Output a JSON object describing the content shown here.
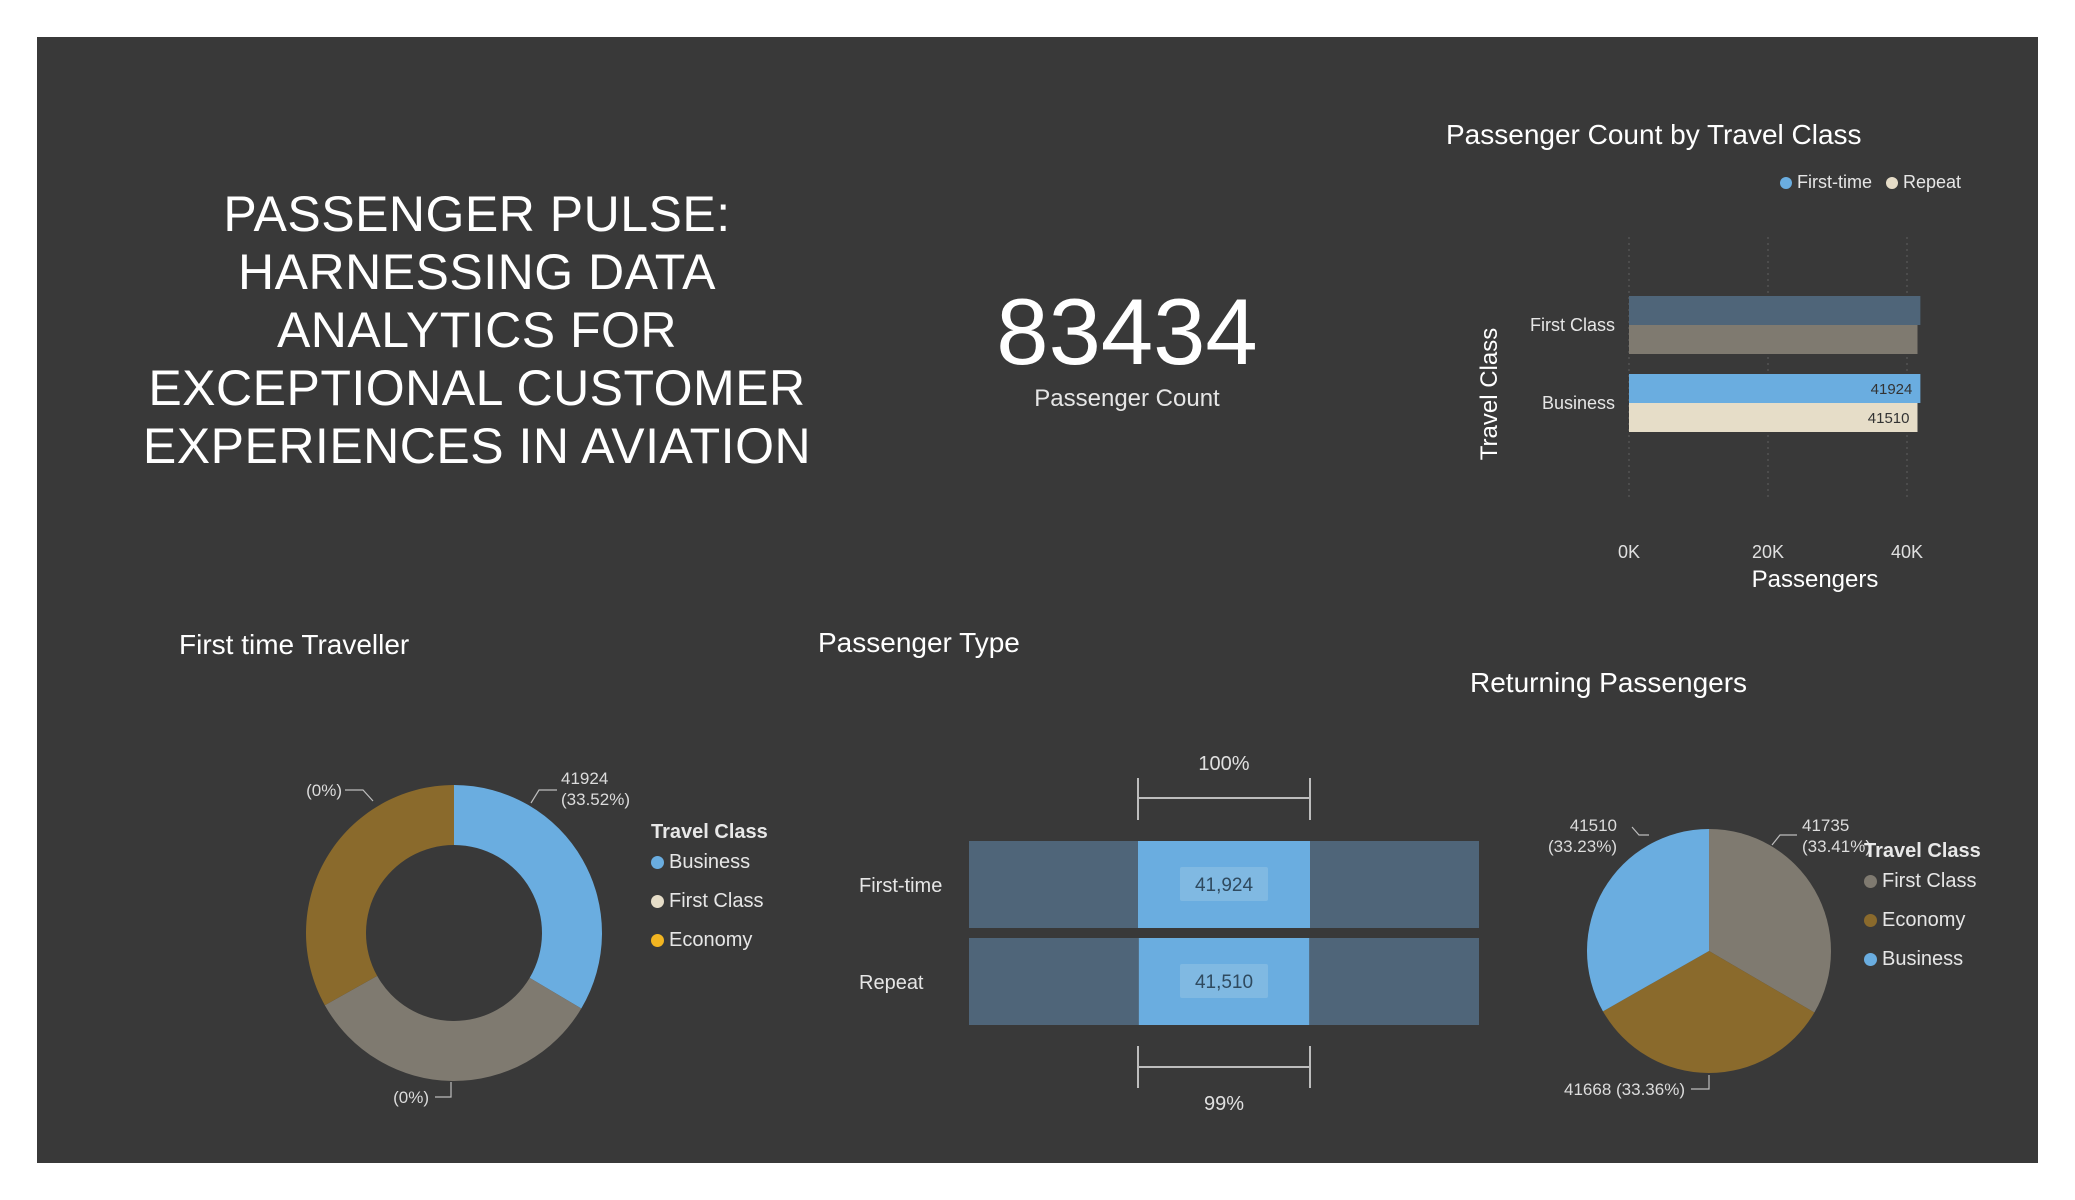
{
  "headline": {
    "lines": [
      "PASSENGER PULSE:",
      "HARNESSING DATA",
      "ANALYTICS FOR",
      "EXCEPTIONAL CUSTOMER",
      "EXPERIENCES IN AVIATION"
    ]
  },
  "kpi": {
    "value": "83434",
    "label": "Passenger Count"
  },
  "colors": {
    "background": "#393939",
    "business": "#6aade0",
    "first_class": "#e6ddc8",
    "economy": "#f2b521",
    "first_time": "#6aade0",
    "repeat": "#e6ddc8",
    "donut_gray": "#7f7a70",
    "donut_brown": "#8a6a2c",
    "funnel_track": "#4f6579"
  },
  "chart_data": [
    {
      "id": "class-bar",
      "type": "bar",
      "orientation": "horizontal",
      "title": "Passenger Count by Travel Class",
      "xlabel": "Passengers",
      "ylabel": "Travel Class",
      "categories": [
        "First Class",
        "Business"
      ],
      "series": [
        {
          "name": "First-time",
          "values": [
            41924,
            41924
          ],
          "labels": [
            "",
            "41924"
          ]
        },
        {
          "name": "Repeat",
          "values": [
            41510,
            41510
          ],
          "labels": [
            "",
            "41510"
          ]
        }
      ],
      "xticks": [
        "0K",
        "20K",
        "40K"
      ],
      "xlim": [
        0,
        40000
      ],
      "legend": "top-right"
    },
    {
      "id": "first-time-donut",
      "type": "pie",
      "variant": "donut",
      "title": "First time Traveller",
      "legend_title": "Travel Class",
      "legend": [
        "Business",
        "First Class",
        "Economy"
      ],
      "slices": [
        {
          "value": 41924,
          "percent": 33.52,
          "label": "41924\n(33.52%)"
        },
        {
          "value": 41736,
          "percent": 33.37,
          "label": "(0%)"
        },
        {
          "value": 41410,
          "percent": 33.11,
          "label": "(0%)"
        }
      ]
    },
    {
      "id": "passenger-type-funnel",
      "type": "bar",
      "variant": "funnel",
      "title": "Passenger Type",
      "categories": [
        "First-time",
        "Repeat"
      ],
      "values": [
        41924,
        41510
      ],
      "value_labels": [
        "41,924",
        "41,510"
      ],
      "top_percent": "100%",
      "bottom_percent": "99%"
    },
    {
      "id": "returning-pie",
      "type": "pie",
      "title": "Returning Passengers",
      "legend_title": "Travel Class",
      "legend": [
        "First Class",
        "Economy",
        "Business"
      ],
      "slices": [
        {
          "name": "First Class",
          "value": 41735,
          "percent": 33.41,
          "label": "41735\n(33.41%)"
        },
        {
          "name": "Economy",
          "value": 41668,
          "percent": 33.36,
          "label": "41668 (33.36%)"
        },
        {
          "name": "Business",
          "value": 41510,
          "percent": 33.23,
          "label": "41510\n(33.23%)"
        }
      ]
    }
  ]
}
